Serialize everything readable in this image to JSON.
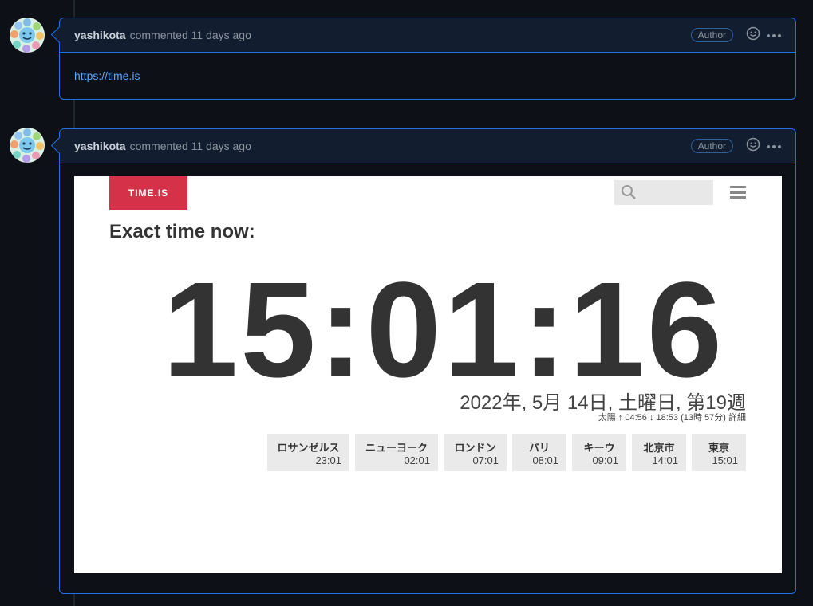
{
  "comments": [
    {
      "author": "yashikota",
      "meta": "commented 11 days ago",
      "badge": "Author",
      "body_link": "https://time.is"
    },
    {
      "author": "yashikota",
      "meta": "commented 11 days ago",
      "badge": "Author",
      "timeis": {
        "logo": "TIME.IS",
        "heading": "Exact time now:",
        "clock": "15:01:16",
        "date": "2022年, 5月 14日, 土曜日, 第19週",
        "sun": "太陽 ↑ 04:56 ↓ 18:53 (13時 57分) 詳細",
        "cities": [
          {
            "name": "ロサンゼルス",
            "time": "23:01"
          },
          {
            "name": "ニューヨーク",
            "time": "02:01"
          },
          {
            "name": "ロンドン",
            "time": "07:01"
          },
          {
            "name": "パリ",
            "time": "08:01"
          },
          {
            "name": "キーウ",
            "time": "09:01"
          },
          {
            "name": "北京市",
            "time": "14:01"
          },
          {
            "name": "東京",
            "time": "15:01"
          }
        ]
      }
    }
  ],
  "icons": {
    "emoji": "smiley-icon",
    "more": "kebab-horizontal-icon",
    "search": "search-icon",
    "menu": "hamburger-icon"
  },
  "colors": {
    "link": "#58a6ff",
    "border": "#1f6feb",
    "logo_bg": "#d53249"
  }
}
